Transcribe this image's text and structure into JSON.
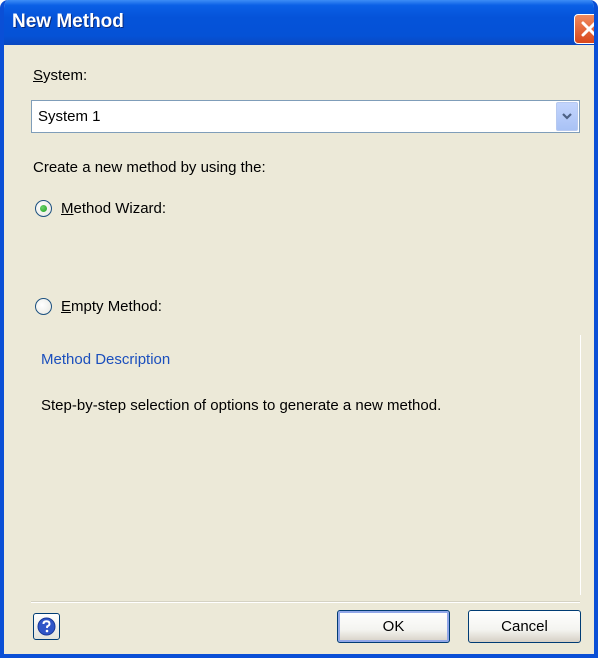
{
  "window": {
    "title": "New Method"
  },
  "system": {
    "label_first": "S",
    "label_rest": "ystem:",
    "selected": "System 1"
  },
  "create_prompt": "Create a new method by using the:",
  "options": [
    {
      "first": "M",
      "rest": "ethod Wizard:",
      "selected": true
    },
    {
      "first": "E",
      "rest": "mpty Method:",
      "selected": false
    }
  ],
  "description": {
    "title": "Method Description",
    "text": "Step-by-step selection of options to generate a new method."
  },
  "buttons": {
    "ok": "OK",
    "cancel": "Cancel"
  },
  "colors": {
    "title_bar": "#0552d6",
    "accent_text": "#1b4fbd",
    "dialog_bg": "#ece9d8"
  },
  "icons": {
    "close": "close-icon",
    "help": "help-icon",
    "dropdown": "chevron-down-icon"
  }
}
